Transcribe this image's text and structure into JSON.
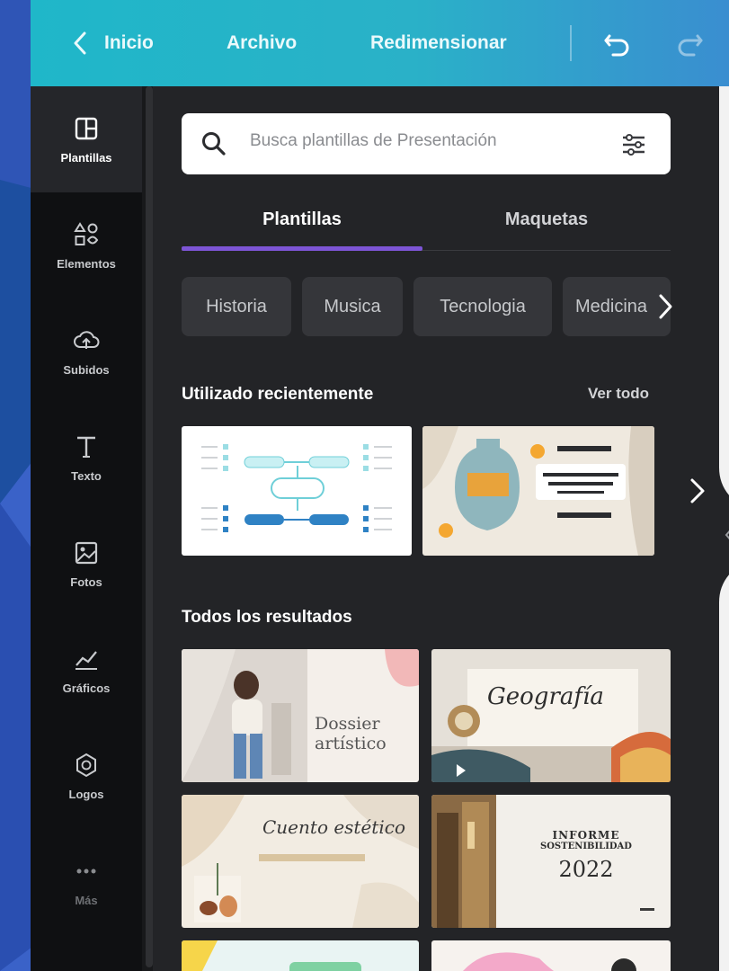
{
  "colors": {
    "accent": "#7d55d6",
    "topbar": "#1fb7c9",
    "rail": "#0f1012",
    "panel": "#232427",
    "chip": "#35363a"
  },
  "topbar": {
    "back_icon": "chevron-left-icon",
    "home_label": "Inicio",
    "file_label": "Archivo",
    "resize_label": "Redimensionar",
    "undo_icon": "undo-icon",
    "redo_icon": "redo-icon"
  },
  "rail": {
    "items": [
      {
        "label": "Plantillas",
        "icon": "templates-icon"
      },
      {
        "label": "Elementos",
        "icon": "elements-icon"
      },
      {
        "label": "Subidos",
        "icon": "upload-cloud-icon"
      },
      {
        "label": "Texto",
        "icon": "text-icon"
      },
      {
        "label": "Fotos",
        "icon": "photo-icon"
      },
      {
        "label": "Gráficos",
        "icon": "chart-icon"
      },
      {
        "label": "Logos",
        "icon": "logo-icon"
      },
      {
        "label": "Más",
        "icon": "more-icon"
      }
    ]
  },
  "search": {
    "placeholder": "Busca plantillas de Presentación",
    "icon": "search-icon",
    "filter_icon": "filter-icon"
  },
  "tabs": [
    {
      "label": "Plantillas",
      "active": true
    },
    {
      "label": "Maquetas",
      "active": false
    }
  ],
  "chips": [
    "Historia",
    "Musica",
    "Tecnologia",
    "Medicina"
  ],
  "recent": {
    "title": "Utilizado recientemente",
    "see_all": "Ver todo"
  },
  "results": {
    "title": "Todos los resultados"
  },
  "templates": {
    "dossier_title": "Dossier",
    "dossier_sub": "artístico",
    "geografia": "Geografía",
    "cuento": "Cuento estético",
    "informe": "INFORME",
    "informe_sub": "SOSTENIBILIDAD",
    "year": "2022"
  }
}
